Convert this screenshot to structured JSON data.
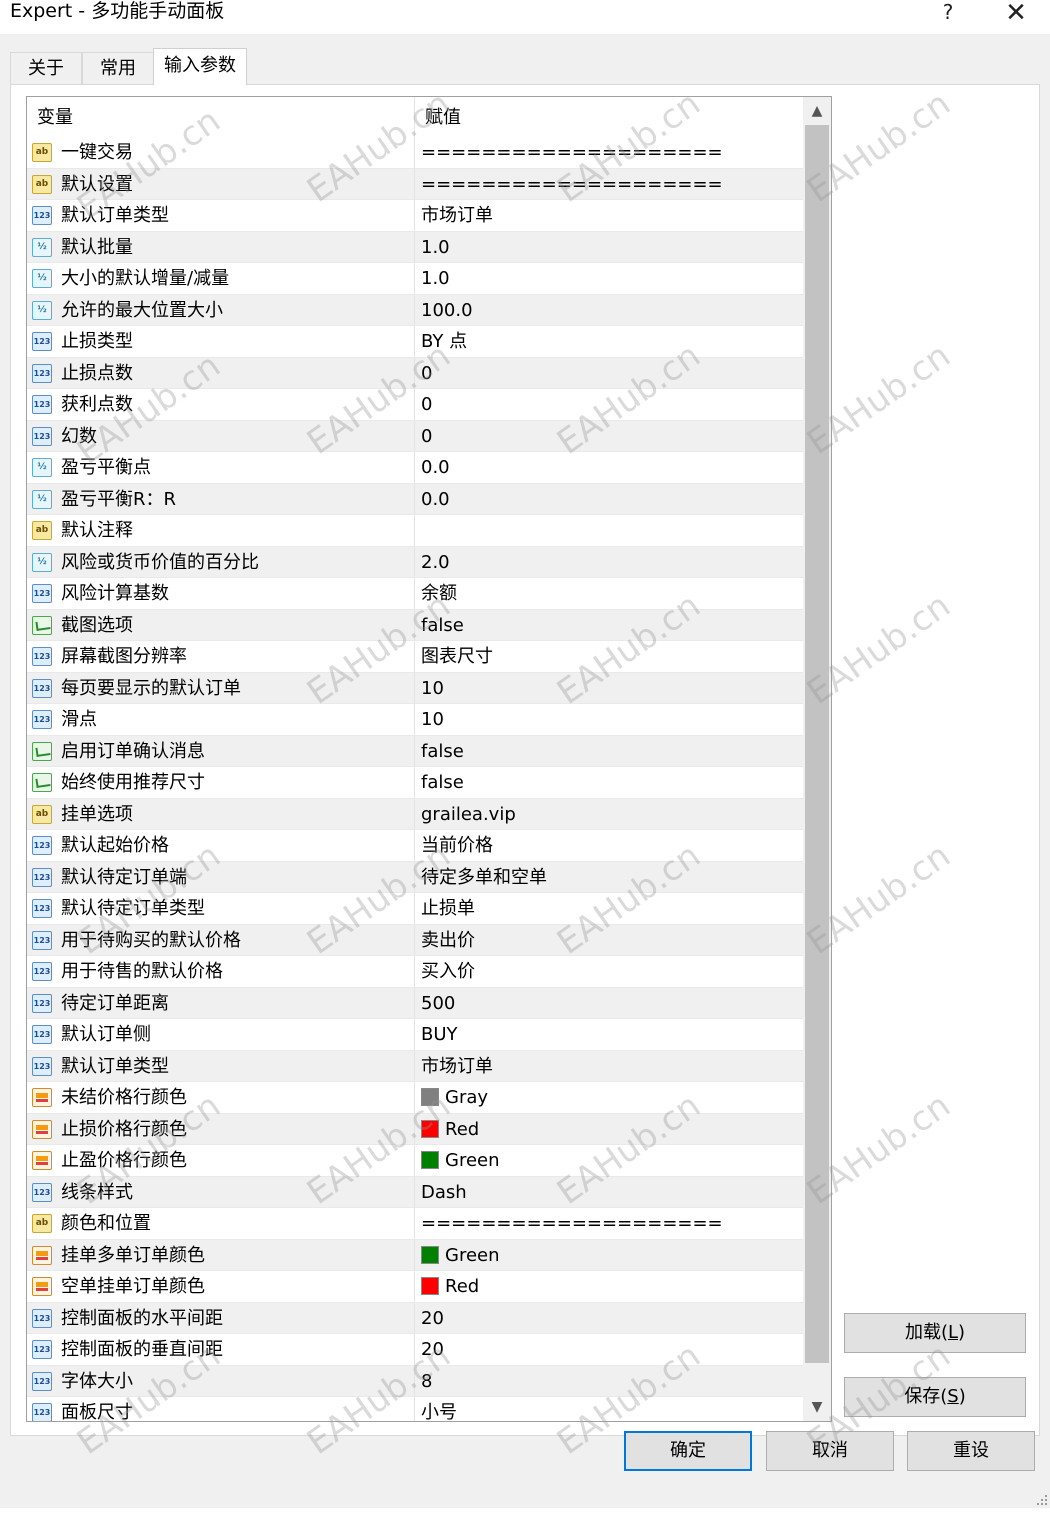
{
  "window": {
    "title": "Expert - 多功能手动面板",
    "help_label": "?",
    "close_label": "✕"
  },
  "tabs": [
    {
      "label": "关于"
    },
    {
      "label": "常用"
    },
    {
      "label": "输入参数"
    }
  ],
  "grid": {
    "header": {
      "variable": "变量",
      "value": "赋值"
    },
    "rows": [
      {
        "icon": "ab",
        "name": "一键交易",
        "value": "===================="
      },
      {
        "icon": "ab",
        "name": "默认设置",
        "value": "===================="
      },
      {
        "icon": "123",
        "name": "默认订单类型",
        "value": "市场订单"
      },
      {
        "icon": "half",
        "name": "默认批量",
        "value": "1.0"
      },
      {
        "icon": "half",
        "name": "大小的默认增量/减量",
        "value": "1.0"
      },
      {
        "icon": "half",
        "name": "允许的最大位置大小",
        "value": "100.0"
      },
      {
        "icon": "123",
        "name": "止损类型",
        "value": "BY 点"
      },
      {
        "icon": "123",
        "name": "止损点数",
        "value": "0"
      },
      {
        "icon": "123",
        "name": "获利点数",
        "value": "0"
      },
      {
        "icon": "123",
        "name": "幻数",
        "value": "0"
      },
      {
        "icon": "half",
        "name": "盈亏平衡点",
        "value": "0.0"
      },
      {
        "icon": "half",
        "name": "盈亏平衡R：R",
        "value": "0.0"
      },
      {
        "icon": "ab",
        "name": "默认注释",
        "value": ""
      },
      {
        "icon": "half",
        "name": "风险或货币价值的百分比",
        "value": "2.0"
      },
      {
        "icon": "123",
        "name": "风险计算基数",
        "value": "余额"
      },
      {
        "icon": "bool",
        "name": "截图选项",
        "value": "false"
      },
      {
        "icon": "123",
        "name": "屏幕截图分辨率",
        "value": "图表尺寸"
      },
      {
        "icon": "123",
        "name": "每页要显示的默认订单",
        "value": "10"
      },
      {
        "icon": "123",
        "name": "滑点",
        "value": "10"
      },
      {
        "icon": "bool",
        "name": "启用订单确认消息",
        "value": "false"
      },
      {
        "icon": "bool",
        "name": "始终使用推荐尺寸",
        "value": "false"
      },
      {
        "icon": "ab",
        "name": "挂单选项",
        "value": "grailea.vip"
      },
      {
        "icon": "123",
        "name": "默认起始价格",
        "value": "当前价格"
      },
      {
        "icon": "123",
        "name": "默认待定订单端",
        "value": "待定多单和空单"
      },
      {
        "icon": "123",
        "name": "默认待定订单类型",
        "value": "止损单"
      },
      {
        "icon": "123",
        "name": "用于待购买的默认价格",
        "value": "卖出价"
      },
      {
        "icon": "123",
        "name": "用于待售的默认价格",
        "value": "买入价"
      },
      {
        "icon": "123",
        "name": "待定订单距离",
        "value": "500"
      },
      {
        "icon": "123",
        "name": "默认订单侧",
        "value": "BUY"
      },
      {
        "icon": "123",
        "name": "默认订单类型",
        "value": "市场订单"
      },
      {
        "icon": "color",
        "name": "未结价格行颜色",
        "value": "Gray",
        "swatch": "#808080"
      },
      {
        "icon": "color",
        "name": "止损价格行颜色",
        "value": "Red",
        "swatch": "#ff0000"
      },
      {
        "icon": "color",
        "name": "止盈价格行颜色",
        "value": "Green",
        "swatch": "#008000"
      },
      {
        "icon": "123",
        "name": "线条样式",
        "value": "Dash"
      },
      {
        "icon": "ab",
        "name": "颜色和位置",
        "value": "===================="
      },
      {
        "icon": "color",
        "name": "挂单多单订单颜色",
        "value": "Green",
        "swatch": "#008000"
      },
      {
        "icon": "color",
        "name": "空单挂单订单颜色",
        "value": "Red",
        "swatch": "#ff0000"
      },
      {
        "icon": "123",
        "name": "控制面板的水平间距",
        "value": "20"
      },
      {
        "icon": "123",
        "name": "控制面板的垂直间距",
        "value": "20"
      },
      {
        "icon": "123",
        "name": "字体大小",
        "value": "8"
      },
      {
        "icon": "123",
        "name": "面板尺寸",
        "value": "小号"
      }
    ]
  },
  "side_buttons": {
    "load": {
      "text": "加载(",
      "key": "L",
      "close": ")"
    },
    "save": {
      "text": "保存(",
      "key": "S",
      "close": ")"
    }
  },
  "footer_buttons": {
    "ok": "确定",
    "cancel": "取消",
    "reset": "重设"
  },
  "watermark": "EAHub.cn",
  "colors": {
    "dialog_bg": "#f0f0f0",
    "default_button_border": "#0078d7"
  }
}
